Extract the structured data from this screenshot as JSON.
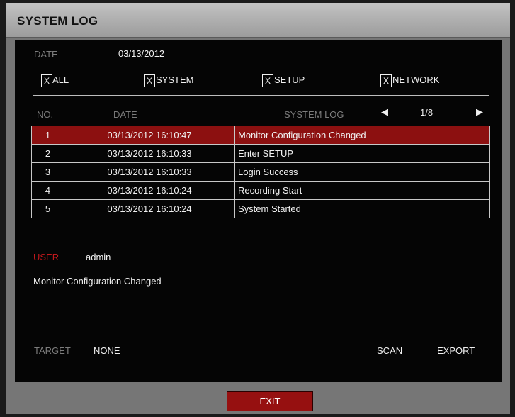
{
  "window": {
    "title": "SYSTEM LOG"
  },
  "date": {
    "label": "DATE",
    "value": "03/13/2012"
  },
  "filters": [
    {
      "mark": "X",
      "label": "ALL"
    },
    {
      "mark": "X",
      "label": "SYSTEM"
    },
    {
      "mark": "X",
      "label": "SETUP"
    },
    {
      "mark": "X",
      "label": "NETWORK"
    }
  ],
  "list_header": {
    "no": "NO.",
    "date": "DATE",
    "log": "SYSTEM LOG"
  },
  "pager": {
    "prev": "◀",
    "page": "1/8",
    "next": "▶"
  },
  "rows": [
    {
      "no": "1",
      "datetime": "03/13/2012  16:10:47",
      "message": "Monitor Configuration Changed"
    },
    {
      "no": "2",
      "datetime": "03/13/2012  16:10:33",
      "message": "Enter SETUP"
    },
    {
      "no": "3",
      "datetime": "03/13/2012  16:10:33",
      "message": "Login Success"
    },
    {
      "no": "4",
      "datetime": "03/13/2012  16:10:24",
      "message": "Recording Start"
    },
    {
      "no": "5",
      "datetime": "03/13/2012  16:10:24",
      "message": "System Started"
    }
  ],
  "selected_row": 0,
  "detail": {
    "user_label": "USER",
    "user_value": "admin",
    "message": "Monitor Configuration Changed"
  },
  "target": {
    "label": "TARGET",
    "value": "NONE"
  },
  "actions": {
    "scan": "SCAN",
    "export": "EXPORT",
    "exit": "EXIT"
  },
  "colors": {
    "selection": "#8c1010",
    "user_label": "#c0181c",
    "exit_button": "#961010"
  }
}
